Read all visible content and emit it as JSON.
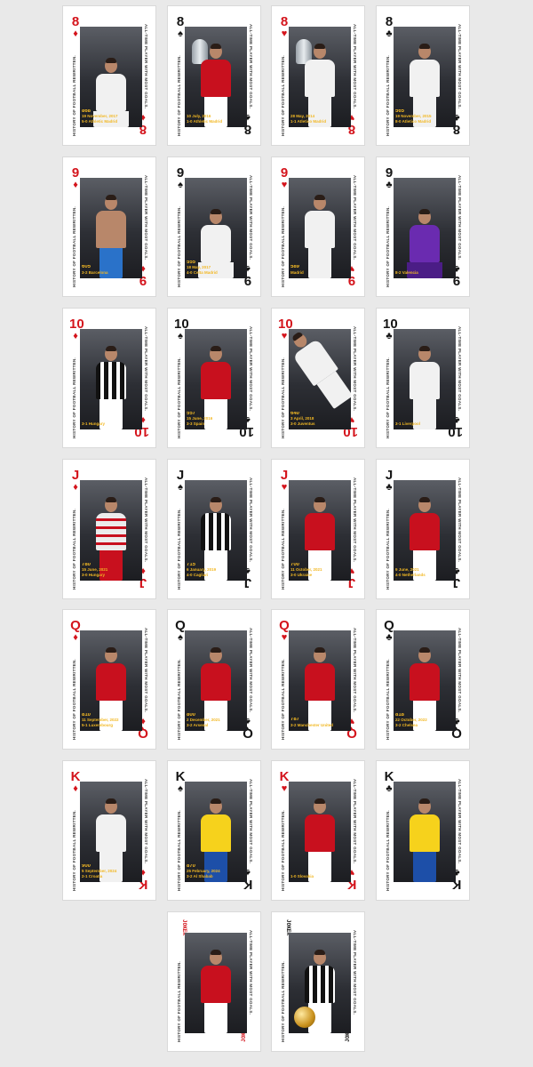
{
  "side_text_left": "HISTORY OF FOOTBALL REWRITTEN.",
  "side_text_right": "ALL-TIME PLAYER WITH MOST GOALS.",
  "joker_label": "JOKER",
  "colors": {
    "red": "#d4141c",
    "black": "#151515",
    "caption": "#f2b824",
    "background": "#e9e9e9"
  },
  "rows": [
    {
      "rank": "8",
      "cards": [
        {
          "suit": "♦",
          "color": "red",
          "goal": "868",
          "date": "19 November, 2017",
          "match": "5-0 Athletic Madrid",
          "kit": "white",
          "pose": "kneel"
        },
        {
          "suit": "♠",
          "color": "black",
          "goal": "",
          "date": "10 July, 2016",
          "match": "1-0 Athletic Madrid",
          "kit": "red",
          "pose": "trophy"
        },
        {
          "suit": "♥",
          "color": "red",
          "goal": "",
          "date": "28 May, 2014",
          "match": "1-1 Atletico Madrid",
          "kit": "white",
          "pose": "trophy"
        },
        {
          "suit": "♣",
          "color": "black",
          "goal": "565",
          "date": "19 November, 2015",
          "match": "8-0 Atletico Madrid",
          "kit": "white",
          "pose": "stand"
        }
      ]
    },
    {
      "rank": "9",
      "cards": [
        {
          "suit": "♦",
          "color": "red",
          "goal": "605",
          "date": "",
          "match": "3-2 Barcelona",
          "kit": "shirtless",
          "pose": "shirt"
        },
        {
          "suit": "♠",
          "color": "black",
          "goal": "555",
          "date": "18 May, 2017",
          "match": "4-0 Celta Madrid",
          "kit": "white",
          "pose": "kneel"
        },
        {
          "suit": "♥",
          "color": "red",
          "goal": "589",
          "date": "",
          "match": "Madrid",
          "kit": "white",
          "pose": "stand"
        },
        {
          "suit": "♣",
          "color": "black",
          "goal": "",
          "date": "",
          "match": "8-2 Valencia",
          "kit": "purple",
          "pose": "kneel"
        }
      ]
    },
    {
      "rank": "10",
      "cards": [
        {
          "suit": "♦",
          "color": "red",
          "goal": "",
          "date": "",
          "match": "3-1 Hungary",
          "kit": "juve",
          "pose": "stand"
        },
        {
          "suit": "♠",
          "color": "black",
          "goal": "557",
          "date": "15 June, 2016",
          "match": "3-3 Spain",
          "kit": "red",
          "pose": "stand"
        },
        {
          "suit": "♥",
          "color": "red",
          "goal": "640",
          "date": "3 April, 2018",
          "match": "3-0 Juventus",
          "kit": "white",
          "pose": "kick"
        },
        {
          "suit": "♣",
          "color": "black",
          "goal": "",
          "date": "",
          "match": "3-1 Liverpool",
          "kit": "white",
          "pose": "kiss"
        }
      ]
    },
    {
      "rank": "J",
      "cards": [
        {
          "suit": "♦",
          "color": "red",
          "goal": "780",
          "date": "15 June, 2021",
          "match": "3-0 Hungary",
          "kit": "hoop",
          "pose": "stand"
        },
        {
          "suit": "♠",
          "color": "black",
          "goal": "715",
          "date": "6 January, 2019",
          "match": "4-0 Cagliari",
          "kit": "juve",
          "pose": "stand"
        },
        {
          "suit": "♥",
          "color": "red",
          "goal": "700",
          "date": "11 October, 2021",
          "match": "3-0 Ukraine",
          "kit": "red",
          "pose": "stand"
        },
        {
          "suit": "♣",
          "color": "black",
          "goal": "",
          "date": "9 June, 2021",
          "match": "4-0 Netherlands",
          "kit": "red",
          "pose": "kiss"
        }
      ]
    },
    {
      "rank": "Q",
      "cards": [
        {
          "suit": "♦",
          "color": "red",
          "goal": "810",
          "date": "11 September, 2022",
          "match": "5-1 Luxembourg",
          "kit": "red",
          "pose": "stand"
        },
        {
          "suit": "♠",
          "color": "black",
          "goal": "800",
          "date": "2 December, 2021",
          "match": "3-2 Arsenal",
          "kit": "red",
          "pose": "stand"
        },
        {
          "suit": "♥",
          "color": "red",
          "goal": "787",
          "date": "",
          "match": "3-2 Manchester United",
          "kit": "red",
          "pose": "stand"
        },
        {
          "suit": "♣",
          "color": "black",
          "goal": "818",
          "date": "22 October, 2022",
          "match": "3-2 Chelsea",
          "kit": "red",
          "pose": "stand"
        }
      ]
    },
    {
      "rank": "K",
      "cards": [
        {
          "suit": "♦",
          "color": "red",
          "goal": "900",
          "date": "5 September, 2024",
          "match": "2-1 Croatia",
          "kit": "white",
          "pose": "stand"
        },
        {
          "suit": "♠",
          "color": "black",
          "goal": "870",
          "date": "25 February, 2024",
          "match": "3-2 Al Shabab",
          "kit": "yellow",
          "pose": "stand"
        },
        {
          "suit": "♥",
          "color": "red",
          "goal": "",
          "date": "",
          "match": "1-0 Slovakia",
          "kit": "red",
          "pose": "hug"
        },
        {
          "suit": "♣",
          "color": "black",
          "goal": "",
          "date": "",
          "match": "",
          "kit": "yellow",
          "pose": "stand"
        }
      ]
    }
  ]
}
